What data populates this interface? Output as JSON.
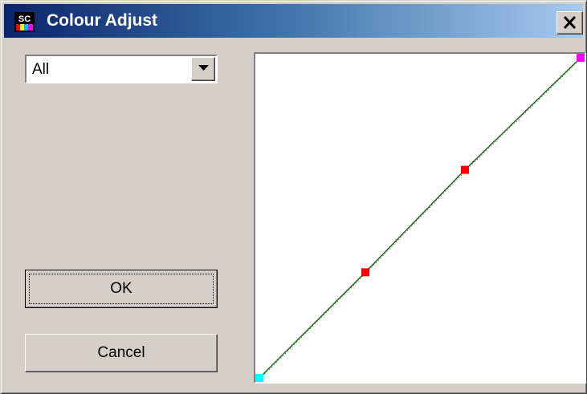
{
  "window": {
    "title": "Colour Adjust",
    "app_icon": "sc-app-icon",
    "app_icon_text": "SC",
    "close_icon": "close-icon"
  },
  "channel_select": {
    "value": "All",
    "dropdown_icon": "chevron-down-icon"
  },
  "buttons": {
    "ok_label": "OK",
    "cancel_label": "Cancel"
  },
  "curve": {
    "line_color": "#1b6b1b",
    "endpoint_low_color": "#00ffff",
    "endpoint_high_color": "#ff00ff",
    "control_point_color": "#ff0000",
    "control_points": [
      {
        "input": 0,
        "output": 0,
        "kind": "endpoint-low"
      },
      {
        "input": 0.33,
        "output": 0.33,
        "kind": "control"
      },
      {
        "input": 0.64,
        "output": 0.65,
        "kind": "control"
      },
      {
        "input": 1,
        "output": 1,
        "kind": "endpoint-high"
      }
    ]
  }
}
